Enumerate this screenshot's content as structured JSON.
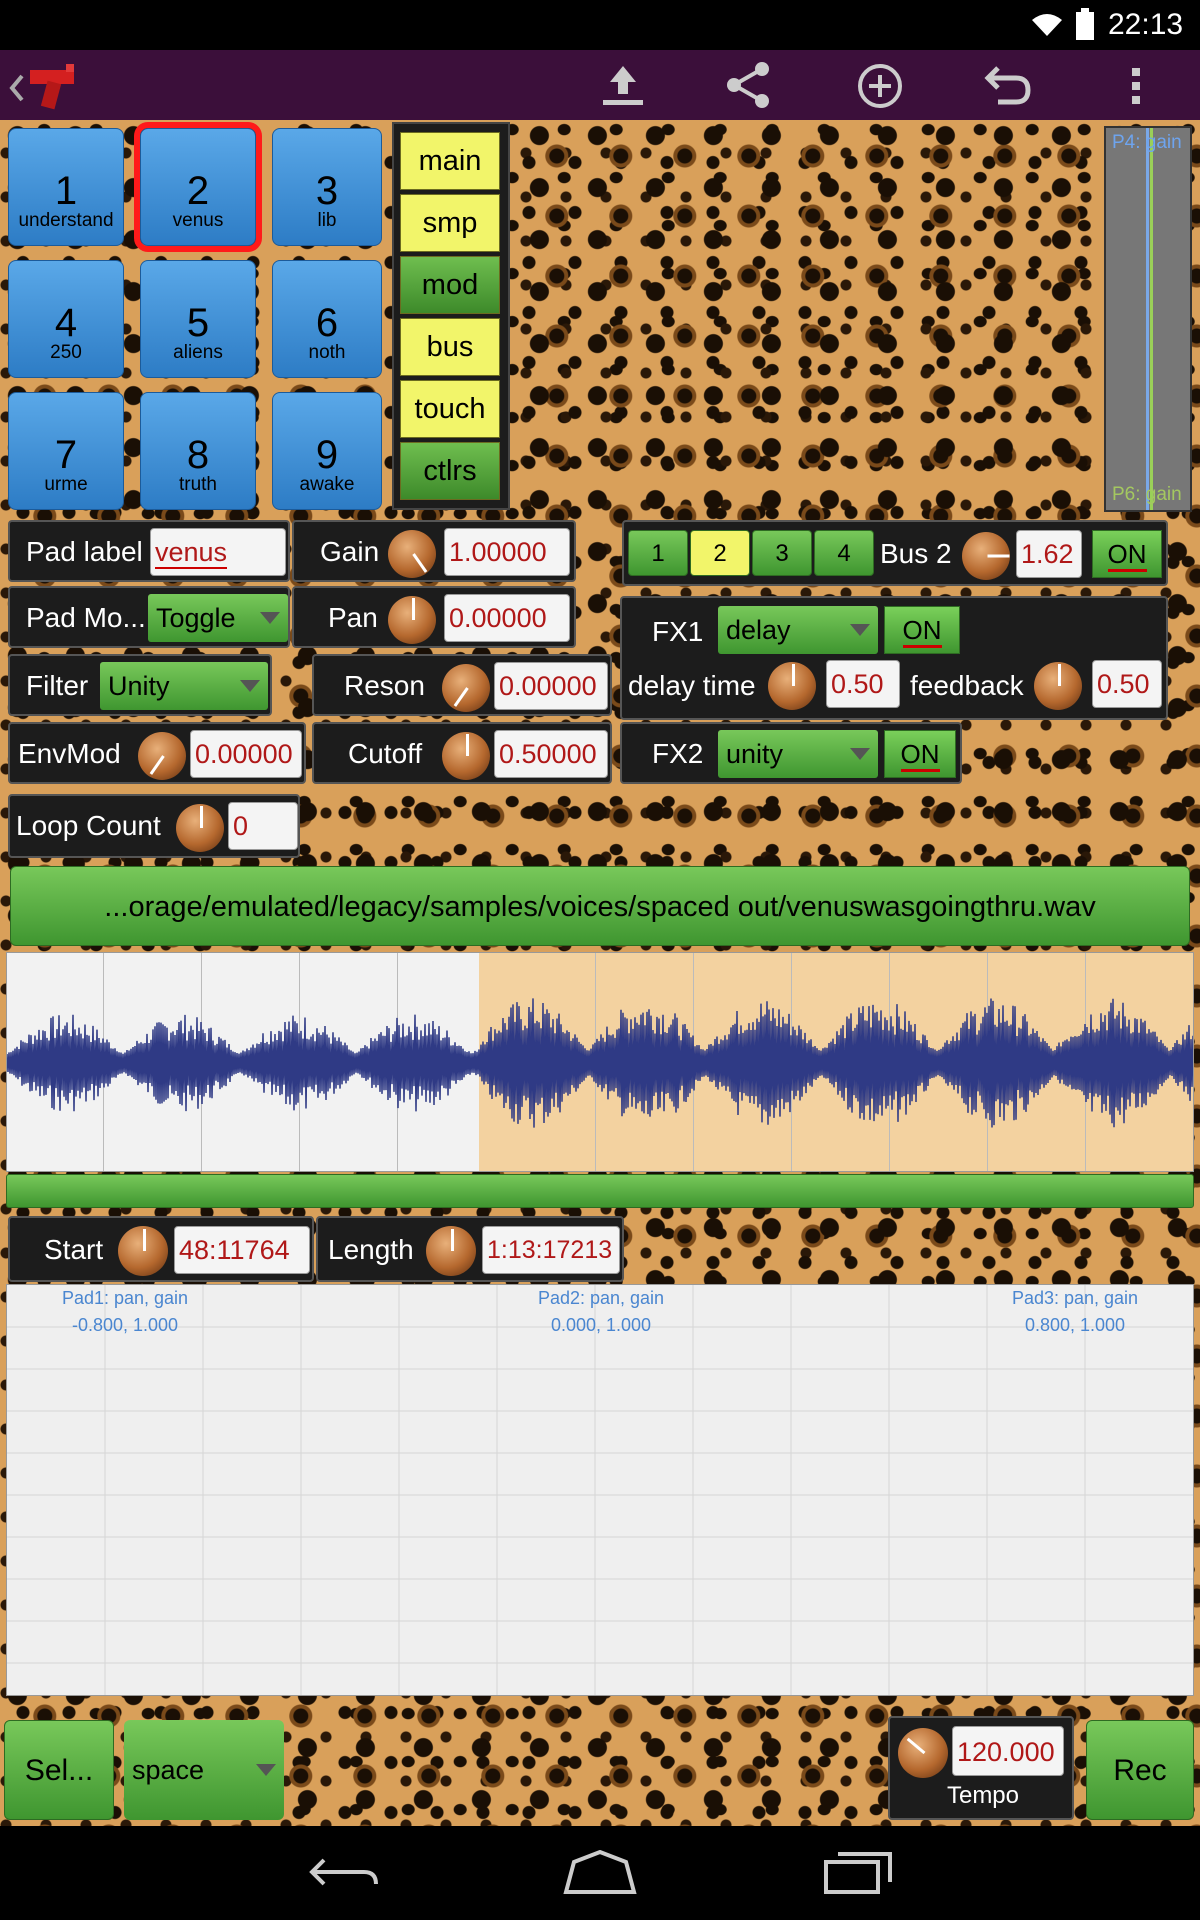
{
  "status": {
    "time": "22:13"
  },
  "toolbar": {
    "icons": [
      "back-chevron-icon",
      "app-logo-icon",
      "upload-icon",
      "share-icon",
      "add-icon",
      "undo-icon",
      "overflow-menu-icon"
    ]
  },
  "pads": [
    {
      "num": "1",
      "label": "understand"
    },
    {
      "num": "2",
      "label": "venus"
    },
    {
      "num": "3",
      "label": "lib"
    },
    {
      "num": "4",
      "label": "250"
    },
    {
      "num": "5",
      "label": "aliens"
    },
    {
      "num": "6",
      "label": "noth"
    },
    {
      "num": "7",
      "label": "urme"
    },
    {
      "num": "8",
      "label": "truth"
    },
    {
      "num": "9",
      "label": "awake"
    }
  ],
  "tabs": [
    "main",
    "smp",
    "mod",
    "bus",
    "touch",
    "ctlrs"
  ],
  "meter": {
    "top_label": "P4: gain",
    "bottom_label": "P6: gain"
  },
  "pad_label": {
    "label": "Pad label",
    "value": "venus"
  },
  "pad_mode": {
    "label": "Pad Mo...",
    "value": "Toggle"
  },
  "filter": {
    "label": "Filter",
    "value": "Unity"
  },
  "envmod": {
    "label": "EnvMod",
    "value": "0.00000"
  },
  "loop_count": {
    "label": "Loop Count",
    "value": "0"
  },
  "gain": {
    "label": "Gain",
    "value": "1.00000"
  },
  "pan": {
    "label": "Pan",
    "value": "0.00000"
  },
  "reson": {
    "label": "Reson",
    "value": "0.00000"
  },
  "cutoff": {
    "label": "Cutoff",
    "value": "0.50000"
  },
  "bus": {
    "buttons": [
      "1",
      "2",
      "3",
      "4"
    ],
    "label": "Bus 2",
    "value": "1.62",
    "on": "ON"
  },
  "fx1": {
    "label": "FX1",
    "effect": "delay",
    "on": "ON",
    "delay_label": "delay time",
    "delay_value": "0.50",
    "feedback_label": "feedback",
    "feedback_value": "0.50"
  },
  "fx2": {
    "label": "FX2",
    "effect": "unity",
    "on": "ON"
  },
  "sample_path": "...orage/emulated/legacy/samples/voices/spaced out/venuswasgoingthru.wav",
  "start": {
    "label": "Start",
    "value": "48:11764"
  },
  "length": {
    "label": "Length",
    "value": "1:13:17213"
  },
  "xy": [
    {
      "title": "Pad1: pan, gain",
      "values": "-0.800, 1.000"
    },
    {
      "title": "Pad2: pan, gain",
      "values": "0.000, 1.000"
    },
    {
      "title": "Pad3: pan, gain",
      "values": "0.800, 1.000"
    }
  ],
  "bottom": {
    "select": "Sel...",
    "mode": "space",
    "tempo_value": "120.000",
    "tempo_label": "Tempo",
    "rec": "Rec"
  },
  "colors": {
    "accent_green": "#4fa83a",
    "pad_blue": "#3a8ad5",
    "tab_yellow": "#f2f56a",
    "actionbar": "#3b0f3a",
    "waveform": "#2f3a85"
  }
}
